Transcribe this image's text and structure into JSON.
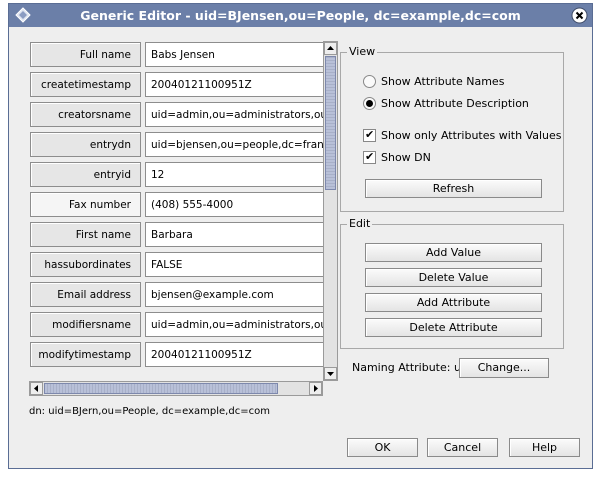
{
  "window": {
    "title": "Generic Editor - uid=BJensen,ou=People, dc=example,dc=com",
    "title_icon": "diamond-app-icon",
    "close_icon": "close-icon"
  },
  "attributes": [
    {
      "name": "Full name",
      "value": "Babs Jensen"
    },
    {
      "name": "createtimestamp",
      "value": "20040121100951Z"
    },
    {
      "name": "creatorsname",
      "value": "uid=admin,ou=administrators,ou=topologymanagement,o=netscaperoot"
    },
    {
      "name": "entrydn",
      "value": "uid=bjensen,ou=people,dc=france,dc=example,dc=com"
    },
    {
      "name": "entryid",
      "value": "12"
    },
    {
      "name": "Fax number",
      "value": "(408) 555-4000"
    },
    {
      "name": "First name",
      "value": "Barbara"
    },
    {
      "name": "hassubordinates",
      "value": "FALSE"
    },
    {
      "name": "Email address",
      "value": "bjensen@example.com"
    },
    {
      "name": "modifiersname",
      "value": "uid=admin,ou=administrators,ou=topologymanagement,o=netscaperoot"
    },
    {
      "name": "modifytimestamp",
      "value": "20040121100951Z"
    }
  ],
  "dn_text": "dn: uid=BJern,ou=People, dc=example,dc=com",
  "view": {
    "title": "View",
    "show_names": "Show Attribute Names",
    "show_descriptions": "Show Attribute Description",
    "only_with_values": "Show only Attributes with Values",
    "show_dn": "Show DN",
    "refresh": "Refresh",
    "selected_radio": "Show Attribute Description"
  },
  "edit": {
    "title": "Edit",
    "add_value": "Add Value",
    "delete_value": "Delete Value",
    "add_attribute": "Add Attribute",
    "delete_attribute": "Delete Attribute"
  },
  "naming": {
    "label": "Naming Attribute: uid",
    "change": "Change..."
  },
  "footer": {
    "ok": "OK",
    "cancel": "Cancel",
    "help": "Help"
  }
}
